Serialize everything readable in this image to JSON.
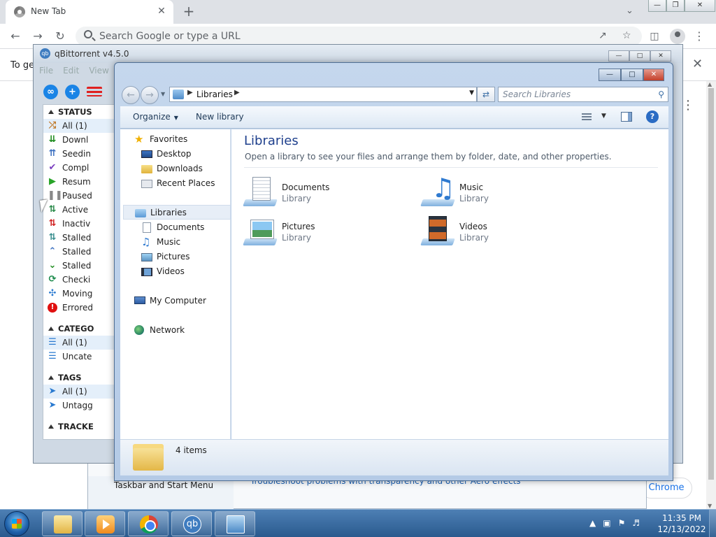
{
  "chrome": {
    "tab_title": "New Tab",
    "tab_close": "✕",
    "new_tab": "+",
    "omnibox_placeholder": "Search Google or type a URL",
    "infobar_text": "To ge",
    "infobar_close": "✕",
    "footer_button": "Chrome"
  },
  "qbittorrent": {
    "title": "qBittorrent v4.5.0",
    "logo": "qb",
    "menu": [
      "File",
      "Edit",
      "View"
    ],
    "sections": {
      "status": "STATUS",
      "categories": "CATEGO",
      "tags": "TAGS",
      "trackers": "TRACKE"
    },
    "status_items": [
      {
        "label": "All (1)",
        "icon": "shuffle-icon",
        "color": "#c07a2a"
      },
      {
        "label": "Downl",
        "icon": "download-icon",
        "color": "#1a8a1a"
      },
      {
        "label": "Seedin",
        "icon": "upload-icon",
        "color": "#3a6fc0"
      },
      {
        "label": "Compl",
        "icon": "check-icon",
        "color": "#7b3fbf"
      },
      {
        "label": "Resum",
        "icon": "play-icon",
        "color": "#28a428"
      },
      {
        "label": "Paused",
        "icon": "pause-icon",
        "color": "#888888"
      },
      {
        "label": "Active",
        "icon": "sort-icon",
        "color": "#2a8a4a"
      },
      {
        "label": "Inactiv",
        "icon": "inactive-icon",
        "color": "#d02020"
      },
      {
        "label": "Stalled",
        "icon": "stalled-both-icon",
        "color": "#3a8f8f"
      },
      {
        "label": "Stalled",
        "icon": "stalled-up-icon",
        "color": "#3a6fc0"
      },
      {
        "label": "Stalled",
        "icon": "stalled-down-icon",
        "color": "#1a8a1a"
      },
      {
        "label": "Checki",
        "icon": "refresh-icon",
        "color": "#1a8a4a"
      },
      {
        "label": "Moving",
        "icon": "move-icon",
        "color": "#2a7ad0"
      },
      {
        "label": "Errored",
        "icon": "error-icon",
        "color": "#e01010"
      }
    ],
    "category_items": [
      {
        "label": "All (1)",
        "icon": "list-icon",
        "color": "#2a7ad0"
      },
      {
        "label": "Uncate",
        "icon": "list-icon",
        "color": "#2a7ad0"
      }
    ],
    "tag_items": [
      {
        "label": "All (1)",
        "icon": "tag-icon",
        "color": "#2a7ad0"
      },
      {
        "label": "Untagg",
        "icon": "tag-icon",
        "color": "#2a7ad0"
      }
    ]
  },
  "personalization": {
    "taskbar_link": "Taskbar and Start Menu",
    "troubleshoot_link": "Troubleshoot problems with transparency and other Aero effects"
  },
  "explorer": {
    "breadcrumb": "Libraries",
    "search_placeholder": "Search Libraries",
    "organize": "Organize",
    "new_library": "New library",
    "help": "?",
    "nav": {
      "favorites": "Favorites",
      "desktop": "Desktop",
      "downloads": "Downloads",
      "recent_places": "Recent Places",
      "libraries": "Libraries",
      "documents": "Documents",
      "music": "Music",
      "pictures": "Pictures",
      "videos": "Videos",
      "my_computer": "My Computer",
      "network": "Network"
    },
    "heading": "Libraries",
    "subheading": "Open a library to see your files and arrange them by folder, date, and other properties.",
    "libraries": [
      {
        "name": "Documents",
        "type": "Library"
      },
      {
        "name": "Music",
        "type": "Library"
      },
      {
        "name": "Pictures",
        "type": "Library"
      },
      {
        "name": "Videos",
        "type": "Library"
      }
    ],
    "status_count": "4 items"
  },
  "taskbar": {
    "clock_time": "11:35 PM",
    "clock_date": "12/13/2022",
    "qb_label": "qb"
  }
}
